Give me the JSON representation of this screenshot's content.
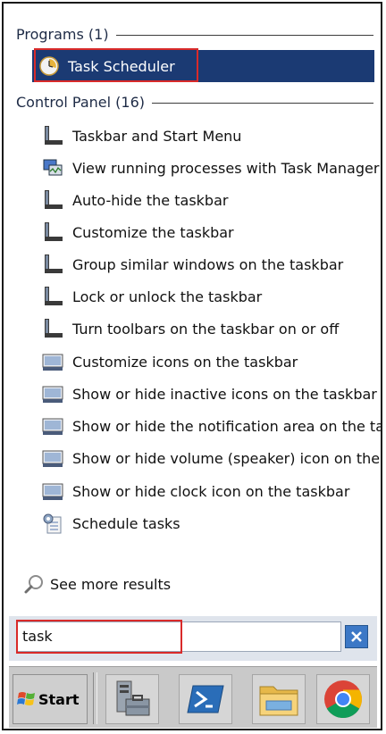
{
  "programs": {
    "header": "Programs (1)",
    "items": [
      {
        "label": "Task Scheduler",
        "icon": "clock-icon"
      }
    ]
  },
  "control_panel": {
    "header": "Control Panel (16)",
    "items": [
      {
        "label": "Taskbar and Start Menu",
        "icon": "taskbar-settings-icon"
      },
      {
        "label": "View running processes with Task Manager",
        "icon": "task-manager-icon"
      },
      {
        "label": "Auto-hide the taskbar",
        "icon": "taskbar-settings-icon"
      },
      {
        "label": "Customize the taskbar",
        "icon": "taskbar-settings-icon"
      },
      {
        "label": "Group similar windows on the taskbar",
        "icon": "taskbar-settings-icon"
      },
      {
        "label": "Lock or unlock the taskbar",
        "icon": "taskbar-settings-icon"
      },
      {
        "label": "Turn toolbars on the taskbar on or off",
        "icon": "taskbar-settings-icon"
      },
      {
        "label": "Customize icons on the taskbar",
        "icon": "notification-area-icon"
      },
      {
        "label": "Show or hide inactive icons on the taskbar",
        "icon": "notification-area-icon"
      },
      {
        "label": "Show or hide the notification area on the taskbar",
        "icon": "notification-area-icon"
      },
      {
        "label": "Show or hide volume (speaker) icon on the taskbar",
        "icon": "notification-area-icon"
      },
      {
        "label": "Show or hide clock icon on the taskbar",
        "icon": "notification-area-icon"
      },
      {
        "label": "Schedule tasks",
        "icon": "admin-tools-icon"
      }
    ]
  },
  "see_more": {
    "label": "See more results",
    "icon": "search-icon"
  },
  "search": {
    "value": "task",
    "clear_icon": "close-icon"
  },
  "taskbar": {
    "start_label": "Start",
    "apps": [
      {
        "name": "server-manager-icon"
      },
      {
        "name": "powershell-icon"
      },
      {
        "name": "file-explorer-icon"
      },
      {
        "name": "chrome-icon"
      }
    ]
  },
  "colors": {
    "selection": "#1b3a73",
    "highlight_border": "#d92a2a",
    "header_text": "#1e2b46"
  }
}
